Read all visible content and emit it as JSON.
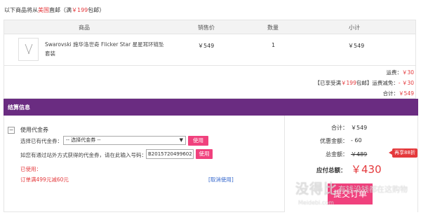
{
  "shipping_note": {
    "prefix": "以下商品将从",
    "origin": "美国",
    "suffix": "直邮（满",
    "threshold": "￥199",
    "tail": "包邮）"
  },
  "cart": {
    "headers": [
      "商品",
      "销售价",
      "数量",
      "小计"
    ],
    "rows": [
      {
        "name_line1": "Swarovski 施华洛世奇 Flicker Star 星星耳环链坠",
        "name_line2": "套装",
        "price": "￥549",
        "qty": "1",
        "subtotal": "￥549"
      }
    ]
  },
  "summary": {
    "shipping_label": "运费：",
    "shipping_value": "￥30",
    "free_prefix": "【已享受满",
    "free_amount": "￥199",
    "free_suffix": "包邮】运费减免：",
    "free_value": "- ￥30",
    "total_label": "合计：",
    "total_value": "￥549"
  },
  "settlement": {
    "title": "结算信息"
  },
  "coupon": {
    "toggle_symbol": "−",
    "title": "使用代金券",
    "select_label": "选择已有代金券：",
    "select_value": "-- 选择代金券 --",
    "use_button": "使用",
    "code_label": "如您有通过站外方式获得的代金券，请在此输入号码：",
    "code_value": "B2015720499602",
    "code_button": "使用",
    "used_label": "已使用：",
    "used_detail": "订单满499元减60元",
    "cancel_link": "[取消使用]"
  },
  "totals": {
    "subtotal_label": "合计：",
    "subtotal_value": "￥549",
    "discount_label": "优惠金额：",
    "discount_value": "- 60",
    "total_label": "总金额：",
    "total_value": "￥489",
    "badge": "再享88折",
    "pay_label": "应付总额：",
    "pay_value": "￥430",
    "submit": "提交订单"
  },
  "watermark": {
    "main": "没得比",
    "sub": "有钱没钱都在这购物",
    "url": "Meidebi.com"
  },
  "colors": {
    "accent": "#e4393c",
    "brand_purple": "#6a2c81",
    "button_pink": "#f0417d",
    "link_blue": "#3366cc"
  }
}
